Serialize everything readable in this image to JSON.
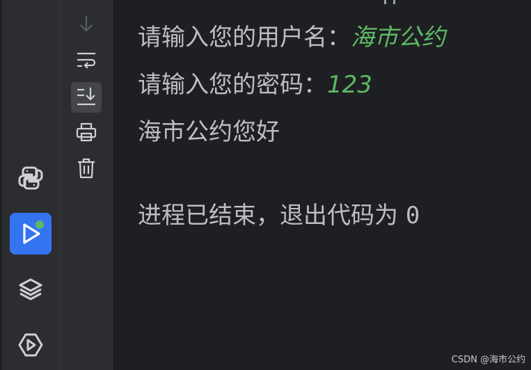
{
  "colors": {
    "background": "#1e1f22",
    "panel": "#2b2d30",
    "text": "#bcbec4",
    "input_text": "#5fb865",
    "accent": "#3574f0",
    "icon": "#ced0d6"
  },
  "left_strip": {
    "icons": [
      "python-icon",
      "run-icon",
      "layers-icon",
      "services-icon"
    ],
    "active": "run-icon"
  },
  "console_toolbar": {
    "icons": [
      "down-arrow-icon",
      "soft-wrap-icon",
      "scroll-to-end-icon",
      "print-icon",
      "trash-icon"
    ],
    "selected": "scroll-to-end-icon"
  },
  "console": {
    "line1_prompt": "请输入您的用户名：",
    "line1_input": "海市公约",
    "line2_prompt": "请输入您的密码：",
    "line2_input": "123",
    "line3": "海市公约您好",
    "exit_message": "进程已结束，退出代码为 ",
    "exit_code": "0"
  },
  "watermark": "CSDN @海市公约"
}
